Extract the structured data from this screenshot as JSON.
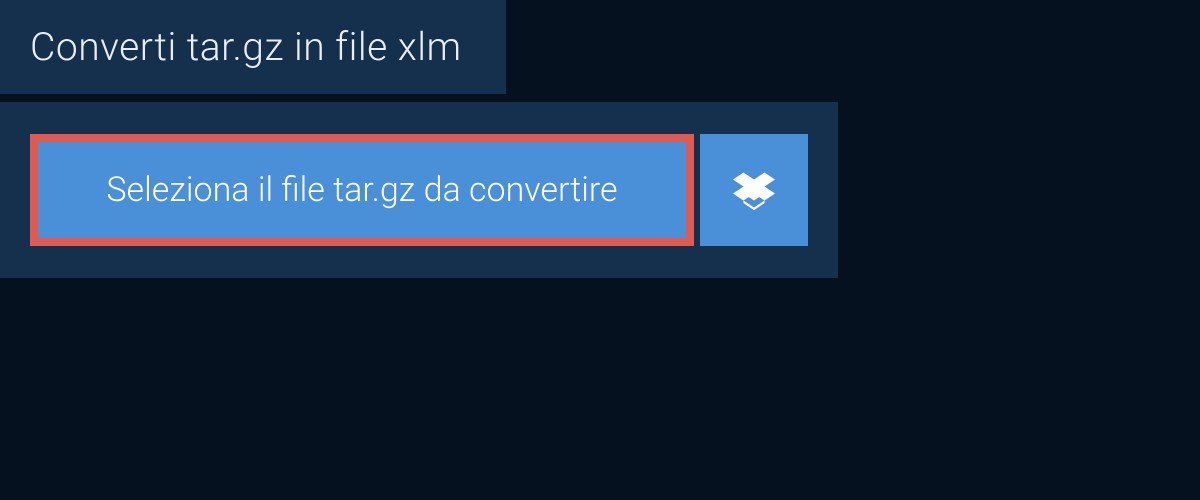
{
  "tab": {
    "title": "Converti tar.gz in file xlm"
  },
  "upload": {
    "select_file_label": "Seleziona il file tar.gz da convertire"
  },
  "colors": {
    "background": "#05111f",
    "panel": "#14304d",
    "button": "#4a90d9",
    "highlight_border": "#e05a52"
  }
}
